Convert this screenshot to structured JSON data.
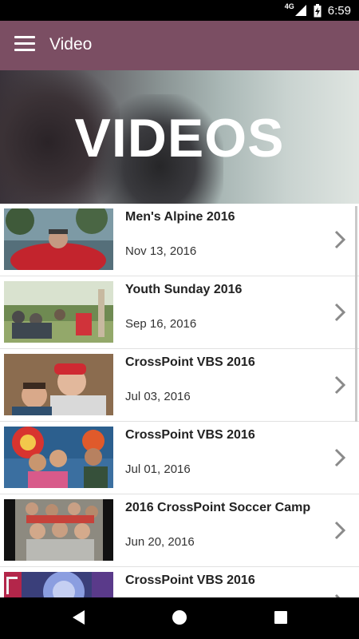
{
  "status_bar": {
    "network": "4G",
    "time": "6:59"
  },
  "app_bar": {
    "title": "Video"
  },
  "hero": {
    "title": "VIDEOS"
  },
  "videos": [
    {
      "title": "Men's Alpine 2016",
      "date": "Nov 13, 2016"
    },
    {
      "title": "Youth Sunday 2016",
      "date": "Sep 16, 2016"
    },
    {
      "title": "CrossPoint VBS 2016",
      "date": "Jul 03, 2016"
    },
    {
      "title": "CrossPoint VBS 2016",
      "date": "Jul 01, 2016"
    },
    {
      "title": "2016 CrossPoint Soccer Camp",
      "date": "Jun 20, 2016"
    },
    {
      "title": "CrossPoint VBS 2016",
      "date": ""
    }
  ],
  "colors": {
    "app_bar": "#7b4e63",
    "status_bar": "#000000",
    "nav_bar": "#000000"
  },
  "icons": {
    "menu": "hamburger-icon",
    "chevron": "chevron-right-icon",
    "back": "triangle-left",
    "home": "circle",
    "recents": "square"
  }
}
